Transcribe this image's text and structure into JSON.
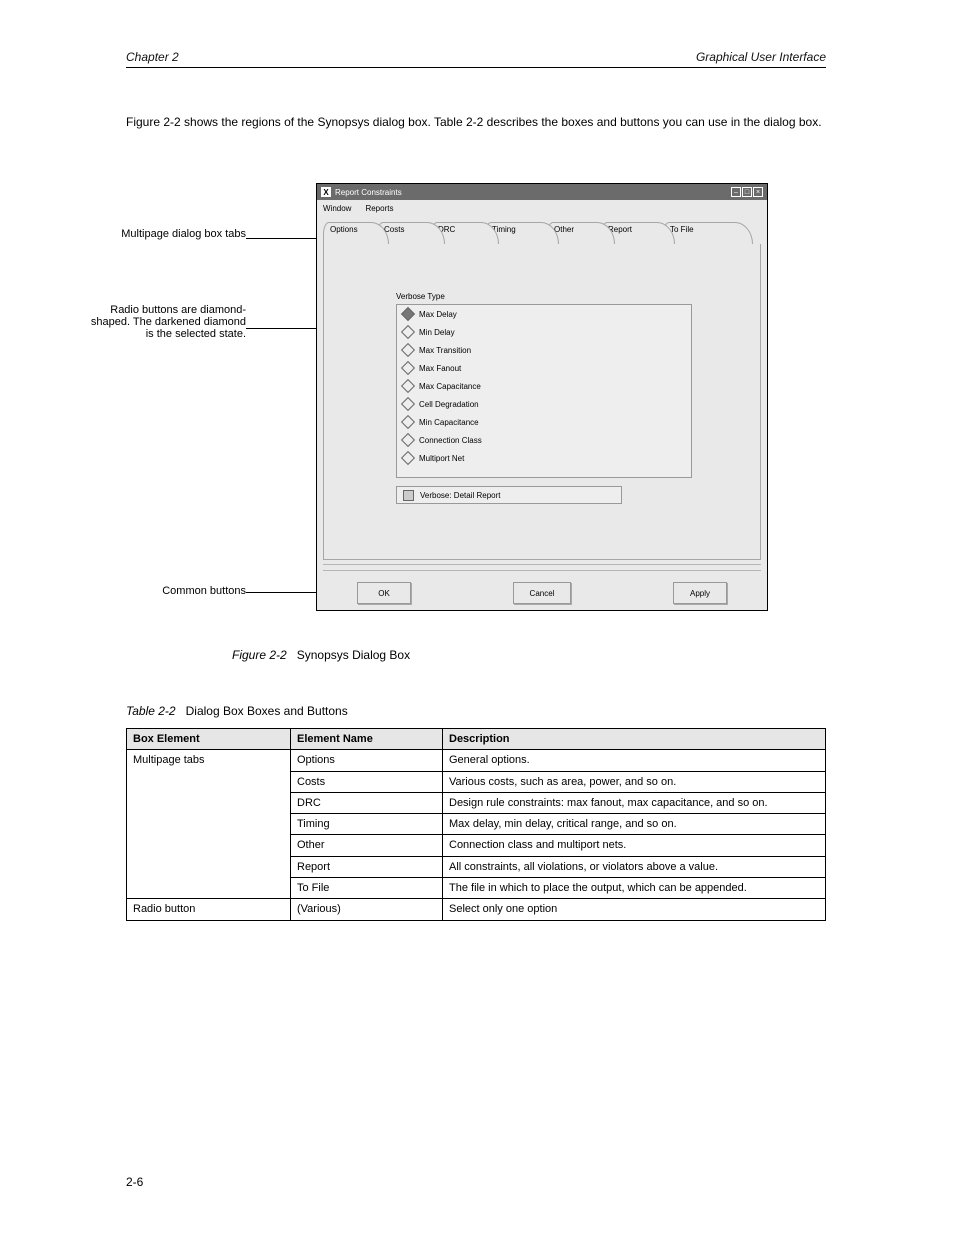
{
  "header": {
    "left": "Chapter 2",
    "right": "Graphical User Interface"
  },
  "intro": "Figure 2-2 shows the regions of the Synopsys dialog box. Table 2-2 describes the boxes and buttons you can use in the dialog box.",
  "callouts": {
    "tabs": "Multipage dialog box tabs",
    "radio": "Radio buttons are diamond-shaped. The darkened diamond is the selected state.",
    "buttons": "Common buttons"
  },
  "window": {
    "title": "Report Constraints",
    "menus": [
      "Window",
      "Reports"
    ],
    "tabs": [
      "Options",
      "Costs",
      "DRC",
      "Timing",
      "Other",
      "Report",
      "To File"
    ],
    "sectionLabel": "Verbose Type",
    "radios": [
      "Max Delay",
      "Min Delay",
      "Max Transition",
      "Max Fanout",
      "Max Capacitance",
      "Cell Degradation",
      "Min Capacitance",
      "Connection Class",
      "Multiport Net"
    ],
    "radioSelectedIndex": 0,
    "checkbox": "Verbose: Detail Report",
    "buttons": [
      "OK",
      "Cancel",
      "Apply"
    ]
  },
  "figCaption": {
    "label": "Figure 2-2",
    "text": "Synopsys Dialog Box"
  },
  "tableTitle": {
    "label": "Table 2-2",
    "text": "Dialog Box Boxes and Buttons"
  },
  "tableHeaders": [
    "Box Element",
    "Element Name",
    "Description"
  ],
  "tableRows": [
    {
      "element": "Multipage tabs",
      "name": "Options",
      "desc": "General options."
    },
    {
      "element": "",
      "name": "Costs",
      "desc": "Various costs, such as area, power, and so on."
    },
    {
      "element": "",
      "name": "DRC",
      "desc": "Design rule constraints: max fanout, max capacitance, and so on."
    },
    {
      "element": "",
      "name": "Timing",
      "desc": "Max delay, min delay, critical range, and so on."
    },
    {
      "element": "",
      "name": "Other",
      "desc": "Connection class and multiport nets."
    },
    {
      "element": "",
      "name": "Report",
      "desc": "All constraints, all violations, or violators above a value."
    },
    {
      "element": "",
      "name": "To File",
      "desc": "The file in which to place the output, which can be appended."
    },
    {
      "element": "Radio button",
      "name": "(Various)",
      "desc": "Select only one option"
    }
  ],
  "pageNumber": "2-6"
}
